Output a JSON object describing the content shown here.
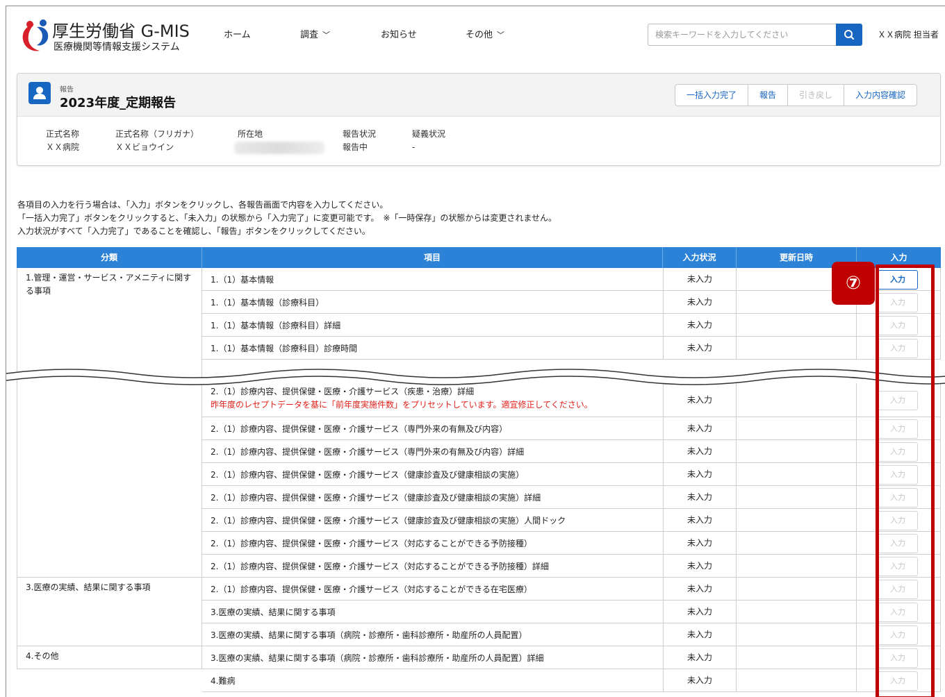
{
  "header": {
    "logo_title": "厚生労働省 G-MIS",
    "logo_subtitle": "医療機関等情報支援システム",
    "nav": {
      "home": "ホーム",
      "survey": "調査",
      "notice": "お知らせ",
      "other": "その他"
    },
    "search_placeholder": "検索キーワードを入力してください",
    "user": "ＸＸ病院 担当者"
  },
  "report": {
    "sub_label": "報告",
    "title": "2023年度_定期報告",
    "buttons": {
      "bulk_complete": "一括入力完了",
      "report": "報告",
      "withdraw": "引き戻し",
      "confirm": "入力内容確認"
    },
    "fields": {
      "official_name_label": "正式名称",
      "official_name_value": "ＸＸ病院",
      "kana_label": "正式名称（フリガナ）",
      "kana_value": "ＸＸビョウイン",
      "location_label": "所在地",
      "status_label": "報告状況",
      "status_value": "報告中",
      "query_label": "疑義状況",
      "query_value": "-"
    }
  },
  "instructions": {
    "line1": "各項目の入力を行う場合は、「入力」ボタンをクリックし、各報告画面で内容を入力してください。",
    "line2": "「一括入力完了」ボタンをクリックすると、「未入力」の状態から「入力完了」に変更可能です。　※「一時保存」の状態からは変更されません。",
    "line3": "入力状況がすべて「入力完了」であることを確認し、「報告」ボタンをクリックしてください。"
  },
  "table": {
    "headers": {
      "category": "分類",
      "item": "項目",
      "status": "入力状況",
      "updated": "更新日時",
      "input": "入力"
    },
    "categories": {
      "c1": "1.管理・運営・サービス・アメニティに関する事項",
      "c3": "3.医療の実績、結果に関する事項",
      "c4": "4.その他"
    },
    "input_label": "入力",
    "status_value": "未入力",
    "rows": [
      {
        "item": "1.（1）基本情報"
      },
      {
        "item": "1.（1）基本情報（診療科目）"
      },
      {
        "item": "1.（1）基本情報（診療科目）詳細"
      },
      {
        "item": "1.（1）基本情報（診療科目）診療時間"
      },
      {
        "item": "2.（1）診療内容、提供保健・医療・介護サービス（疾患・治療）詳細",
        "note": "昨年度のレセプトデータを基に「前年度実施件数」をプリセットしています。適宜修正してください。"
      },
      {
        "item": "2.（1）診療内容、提供保健・医療・介護サービス（専門外来の有無及び内容）"
      },
      {
        "item": "2.（1）診療内容、提供保健・医療・介護サービス（専門外来の有無及び内容）詳細"
      },
      {
        "item": "2.（1）診療内容、提供保健・医療・介護サービス（健康診査及び健康相談の実施）"
      },
      {
        "item": "2.（1）診療内容、提供保健・医療・介護サービス（健康診査及び健康相談の実施）詳細"
      },
      {
        "item": "2.（1）診療内容、提供保健・医療・介護サービス（健康診査及び健康相談の実施）人間ドック"
      },
      {
        "item": "2.（1）診療内容、提供保健・医療・介護サービス（対応することができる予防接種）"
      },
      {
        "item": "2.（1）診療内容、提供保健・医療・介護サービス（対応することができる予防接種）詳細"
      },
      {
        "item": "2.（1）診療内容、提供保健・医療・介護サービス（対応することができる在宅医療）"
      },
      {
        "item": "3.医療の実績、結果に関する事項"
      },
      {
        "item": "3.医療の実績、結果に関する事項（病院・診療所・歯科診療所・助産所の人員配置）"
      },
      {
        "item": "3.医療の実績、結果に関する事項（病院・診療所・歯科診療所・助産所の人員配置）詳細"
      },
      {
        "item": "4.難病"
      }
    ]
  },
  "annotation": {
    "badge": "⑦",
    "color": "#c00000"
  },
  "colors": {
    "accent": "#1766c2",
    "table_header": "#2c82d6",
    "note_red": "#e0201b"
  }
}
